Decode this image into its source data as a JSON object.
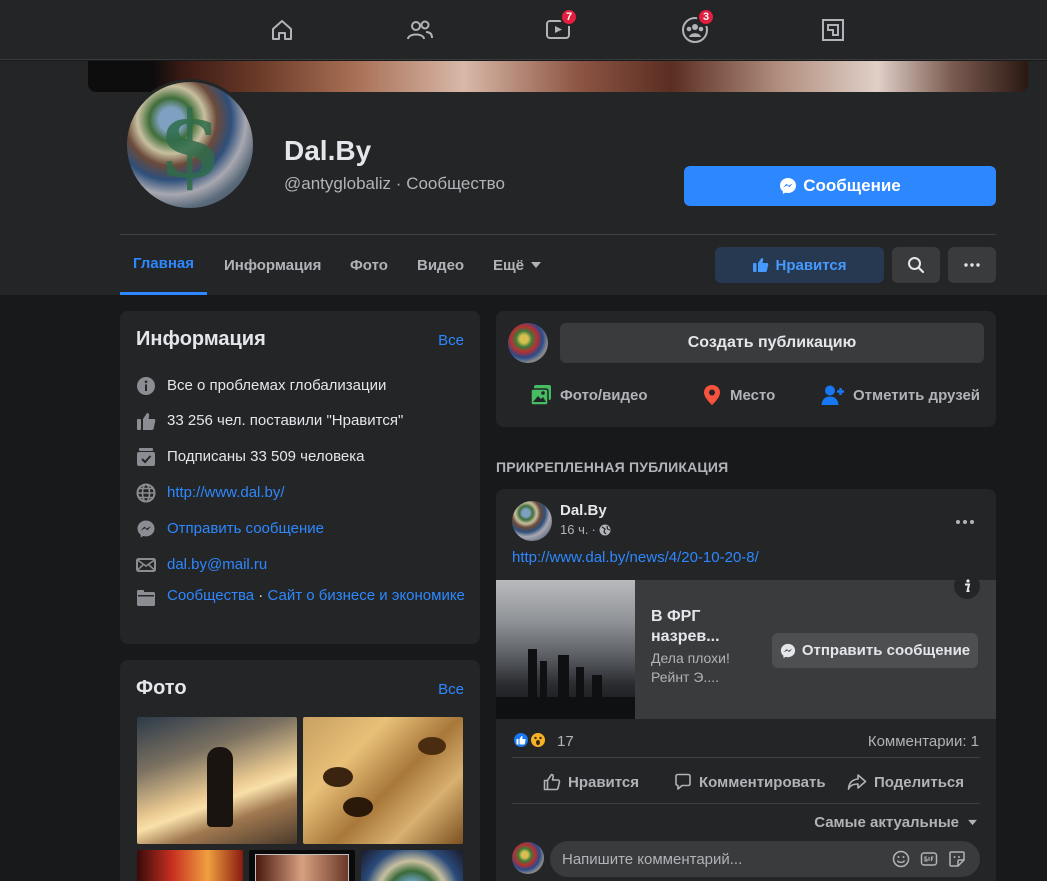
{
  "topnav": {
    "icons": [
      "home-icon",
      "friends-icon",
      "watch-icon",
      "groups-icon",
      "gaming-icon"
    ],
    "watch_badge": "7",
    "groups_badge": "3"
  },
  "page": {
    "name": "Dal.By",
    "handle": "@antyglobaliz",
    "separator": "·",
    "category": "Сообщество",
    "message_button": "Сообщение"
  },
  "tabs": [
    {
      "label": "Главная",
      "active": true
    },
    {
      "label": "Информация"
    },
    {
      "label": "Фото"
    },
    {
      "label": "Видео"
    },
    {
      "label": "Ещё"
    }
  ],
  "header_actions": {
    "like_button": "Нравится"
  },
  "info_card": {
    "title": "Информация",
    "see_all": "Все",
    "rows": [
      {
        "icon": "info-icon",
        "text": "Все о проблемах глобализации"
      },
      {
        "icon": "thumbs-up-icon",
        "text": "33 256 чел. поставили \"Нравится\""
      },
      {
        "icon": "follow-check-icon",
        "text": "Подписаны 33 509 человека"
      },
      {
        "icon": "globe-icon",
        "text": "http://www.dal.by/"
      },
      {
        "icon": "messenger-icon",
        "text": "Отправить сообщение"
      },
      {
        "icon": "envelope-icon",
        "text": "dal.by@mail.ru"
      },
      {
        "icon": "category-icon",
        "cat1": "Сообщества",
        "sep": " · ",
        "cat2": "Сайт о бизнесе и экономике"
      }
    ]
  },
  "photos_card": {
    "title": "Фото",
    "see_all": "Все"
  },
  "composer": {
    "create_button": "Создать публикацию",
    "actions": [
      {
        "icon": "photo-video-icon",
        "label": "Фото/видео",
        "color": "#45bd62"
      },
      {
        "icon": "location-pin-icon",
        "label": "Место",
        "color": "#f5533d"
      },
      {
        "icon": "tag-friends-icon",
        "label": "Отметить друзей",
        "color": "#1877f2"
      }
    ]
  },
  "pinned": {
    "label": "ПРИКРЕПЛЕННАЯ ПУБЛИКАЦИЯ"
  },
  "post": {
    "author": "Dal.By",
    "time": "16 ч.",
    "dot": "·",
    "url": "http://www.dal.by/news/4/20-10-20-8/",
    "preview_title": "В ФРГ назрев...",
    "preview_desc": "Дела плохи! Рейнт Э....",
    "send_message_button": "Отправить сообщение",
    "reactions_count": "17",
    "comments_count": "Комментарии: 1",
    "like_action": "Нравится",
    "comment_action": "Комментировать",
    "share_action": "Поделиться",
    "sort_label": "Самые актуальные",
    "comment_placeholder": "Напишите комментарий..."
  },
  "colors": {
    "accent": "#2d88ff",
    "background": "#18191a",
    "card": "#242526",
    "badge": "#e41e3f"
  }
}
